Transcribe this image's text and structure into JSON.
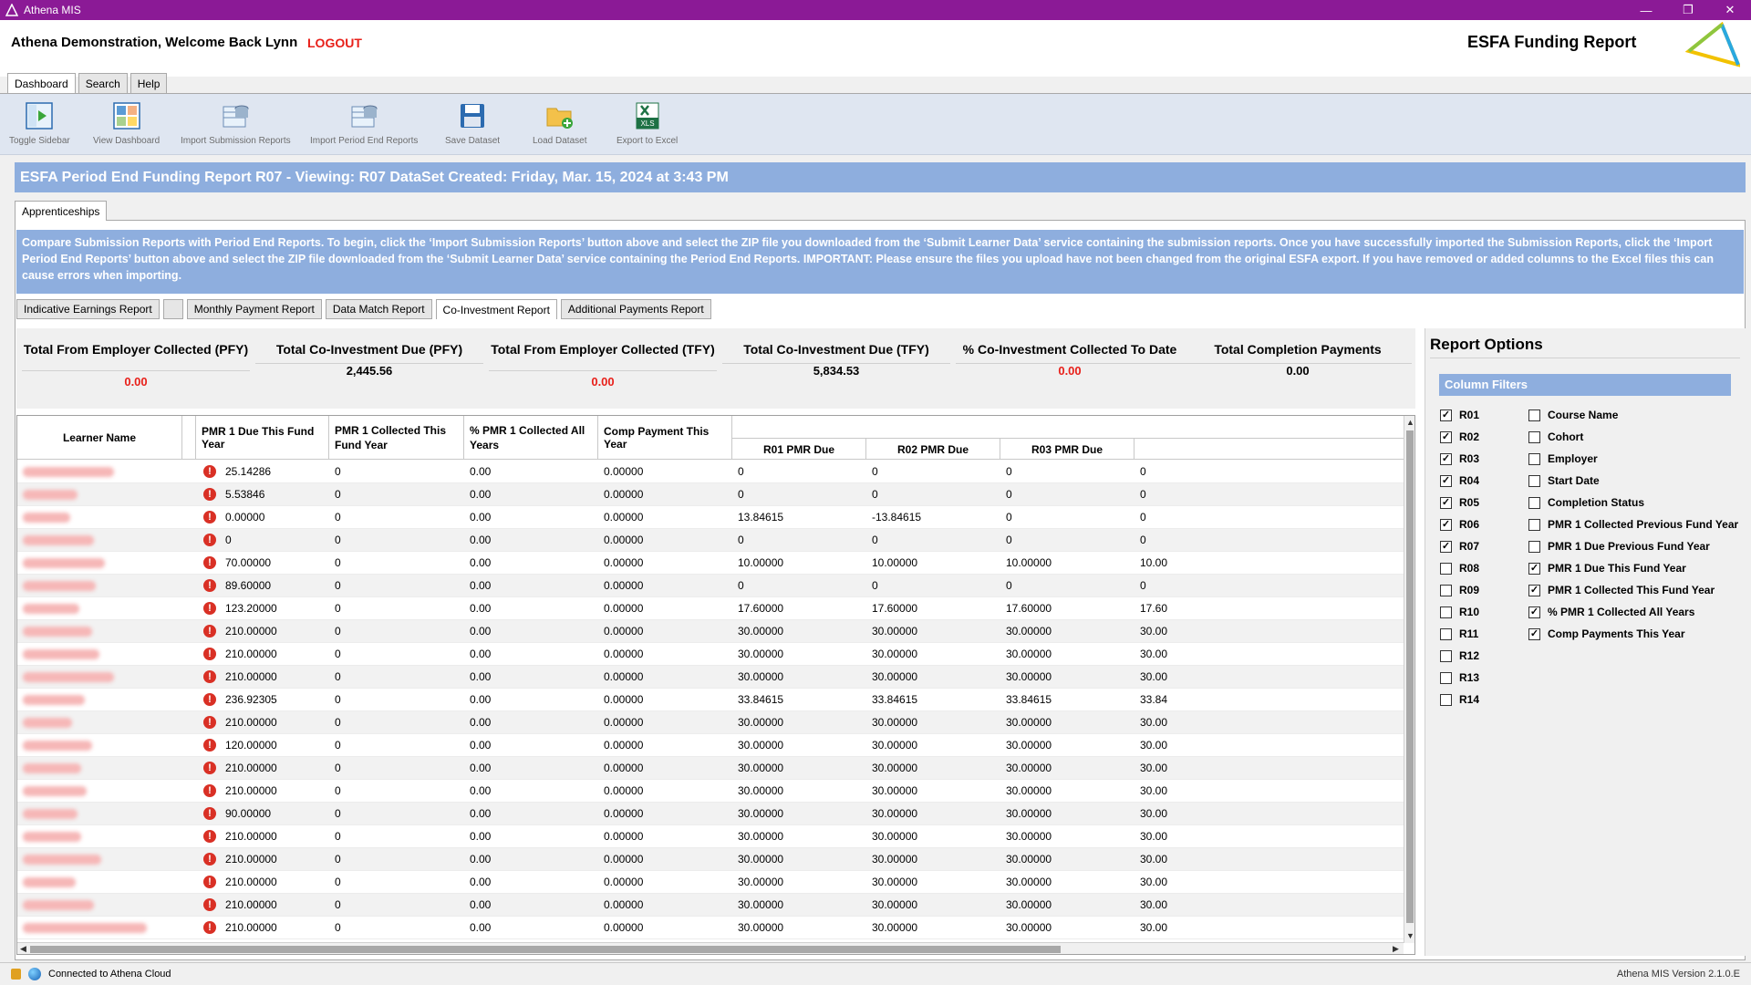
{
  "window": {
    "title": "Athena MIS",
    "min": "—",
    "restore": "❐",
    "close": "✕"
  },
  "header": {
    "welcome": "Athena Demonstration,  Welcome Back Lynn",
    "logout": "LOGOUT",
    "page_title": "ESFA Funding Report"
  },
  "top_tabs": [
    "Dashboard",
    "Search",
    "Help"
  ],
  "ribbon": [
    "Toggle Sidebar",
    "View Dashboard",
    "Import Submission Reports",
    "Import Period End Reports",
    "Save Dataset",
    "Load Dataset",
    "Export to Excel"
  ],
  "report_bar": "ESFA Period End Funding Report R07  - Viewing: R07 DataSet Created: Friday, Mar. 15, 2024 at 3:43 PM",
  "apprenticeship_tab": "Apprenticeships",
  "info_text": "Compare Submission Reports with Period End Reports. To begin, click the ‘Import Submission Reports’ button above and select the ZIP file you downloaded from the ‘Submit Learner Data’ service containing the submission reports. Once you have successfully imported the Submission Reports, click the ‘Import Period End Reports’ button above and select the ZIP file downloaded from the ‘Submit Learner Data’ service containing the Period End Reports. IMPORTANT: Please ensure the files you upload have not been changed from the original ESFA export. If you have removed or added columns to the Excel files this can cause errors when importing.",
  "sub_tabs": [
    "Indicative Earnings Report",
    "",
    "Monthly Payment Report",
    "Data Match Report",
    "Co-Investment Report",
    "Additional Payments Report"
  ],
  "totals": [
    {
      "label": "Total From Employer Collected (PFY)",
      "value": "0.00",
      "red": true
    },
    {
      "label": "Total Co-Investment Due (PFY)",
      "value": "2,445.56",
      "red": false
    },
    {
      "label": "Total From Employer Collected (TFY)",
      "value": "0.00",
      "red": true
    },
    {
      "label": "Total Co-Investment Due (TFY)",
      "value": "5,834.53",
      "red": false
    },
    {
      "label": "% Co-Investment Collected To Date",
      "value": "0.00",
      "red": true
    },
    {
      "label": "Total Completion Payments",
      "value": "0.00",
      "red": false
    }
  ],
  "grid": {
    "headers": {
      "learner": "Learner Name",
      "pmr_due": "PMR 1 Due This Fund Year",
      "pmr_collected": "PMR 1 Collected This Fund Year",
      "pct_collected": "% PMR 1 Collected All Years",
      "comp_payment": "Comp Payment This Year",
      "r01": "R01 PMR Due",
      "r02": "R02 PMR Due",
      "r03": "R03 PMR Due"
    },
    "warn_icon": "!",
    "rows": [
      [
        "25.14286",
        "0",
        "0.00",
        "0.00000",
        "0",
        "0",
        "0",
        "0"
      ],
      [
        "5.53846",
        "0",
        "0.00",
        "0.00000",
        "0",
        "0",
        "0",
        "0"
      ],
      [
        "0.00000",
        "0",
        "0.00",
        "0.00000",
        "13.84615",
        "-13.84615",
        "0",
        "0"
      ],
      [
        "0",
        "0",
        "0.00",
        "0.00000",
        "0",
        "0",
        "0",
        "0"
      ],
      [
        "70.00000",
        "0",
        "0.00",
        "0.00000",
        "10.00000",
        "10.00000",
        "10.00000",
        "10.00"
      ],
      [
        "89.60000",
        "0",
        "0.00",
        "0.00000",
        "0",
        "0",
        "0",
        "0"
      ],
      [
        "123.20000",
        "0",
        "0.00",
        "0.00000",
        "17.60000",
        "17.60000",
        "17.60000",
        "17.60"
      ],
      [
        "210.00000",
        "0",
        "0.00",
        "0.00000",
        "30.00000",
        "30.00000",
        "30.00000",
        "30.00"
      ],
      [
        "210.00000",
        "0",
        "0.00",
        "0.00000",
        "30.00000",
        "30.00000",
        "30.00000",
        "30.00"
      ],
      [
        "210.00000",
        "0",
        "0.00",
        "0.00000",
        "30.00000",
        "30.00000",
        "30.00000",
        "30.00"
      ],
      [
        "236.92305",
        "0",
        "0.00",
        "0.00000",
        "33.84615",
        "33.84615",
        "33.84615",
        "33.84"
      ],
      [
        "210.00000",
        "0",
        "0.00",
        "0.00000",
        "30.00000",
        "30.00000",
        "30.00000",
        "30.00"
      ],
      [
        "120.00000",
        "0",
        "0.00",
        "0.00000",
        "30.00000",
        "30.00000",
        "30.00000",
        "30.00"
      ],
      [
        "210.00000",
        "0",
        "0.00",
        "0.00000",
        "30.00000",
        "30.00000",
        "30.00000",
        "30.00"
      ],
      [
        "210.00000",
        "0",
        "0.00",
        "0.00000",
        "30.00000",
        "30.00000",
        "30.00000",
        "30.00"
      ],
      [
        "90.00000",
        "0",
        "0.00",
        "0.00000",
        "30.00000",
        "30.00000",
        "30.00000",
        "30.00"
      ],
      [
        "210.00000",
        "0",
        "0.00",
        "0.00000",
        "30.00000",
        "30.00000",
        "30.00000",
        "30.00"
      ],
      [
        "210.00000",
        "0",
        "0.00",
        "0.00000",
        "30.00000",
        "30.00000",
        "30.00000",
        "30.00"
      ],
      [
        "210.00000",
        "0",
        "0.00",
        "0.00000",
        "30.00000",
        "30.00000",
        "30.00000",
        "30.00"
      ],
      [
        "210.00000",
        "0",
        "0.00",
        "0.00000",
        "30.00000",
        "30.00000",
        "30.00000",
        "30.00"
      ],
      [
        "210.00000",
        "0",
        "0.00",
        "0.00000",
        "30.00000",
        "30.00000",
        "30.00000",
        "30.00"
      ]
    ]
  },
  "report_options": {
    "title": "Report Options",
    "column_filters": "Column Filters",
    "left_filters": [
      {
        "label": "R01",
        "checked": true
      },
      {
        "label": "R02",
        "checked": true
      },
      {
        "label": "R03",
        "checked": true
      },
      {
        "label": "R04",
        "checked": true
      },
      {
        "label": "R05",
        "checked": true
      },
      {
        "label": "R06",
        "checked": true
      },
      {
        "label": "R07",
        "checked": true
      },
      {
        "label": "R08",
        "checked": false
      },
      {
        "label": "R09",
        "checked": false
      },
      {
        "label": "R10",
        "checked": false
      },
      {
        "label": "R11",
        "checked": false
      },
      {
        "label": "R12",
        "checked": false
      },
      {
        "label": "R13",
        "checked": false
      },
      {
        "label": "R14",
        "checked": false
      }
    ],
    "right_filters": [
      {
        "label": "Course Name",
        "checked": false
      },
      {
        "label": "Cohort",
        "checked": false
      },
      {
        "label": "Employer",
        "checked": false
      },
      {
        "label": "Start Date",
        "checked": false
      },
      {
        "label": "Completion Status",
        "checked": false
      },
      {
        "label": "PMR 1 Collected Previous Fund Year",
        "checked": false
      },
      {
        "label": "PMR 1 Due Previous Fund Year",
        "checked": false
      },
      {
        "label": "PMR 1 Due This Fund Year",
        "checked": true
      },
      {
        "label": "PMR 1 Collected This Fund Year",
        "checked": true
      },
      {
        "label": "% PMR 1 Collected All Years",
        "checked": true
      },
      {
        "label": "Comp Payments This Year",
        "checked": true
      }
    ]
  },
  "status": {
    "connection": "Connected to Athena Cloud",
    "version": "Athena MIS Version 2.1.0.E"
  },
  "colors": {
    "titlebar": "#8b1a96",
    "accent_blue": "#8eaede",
    "alert_red": "#e8201a"
  }
}
